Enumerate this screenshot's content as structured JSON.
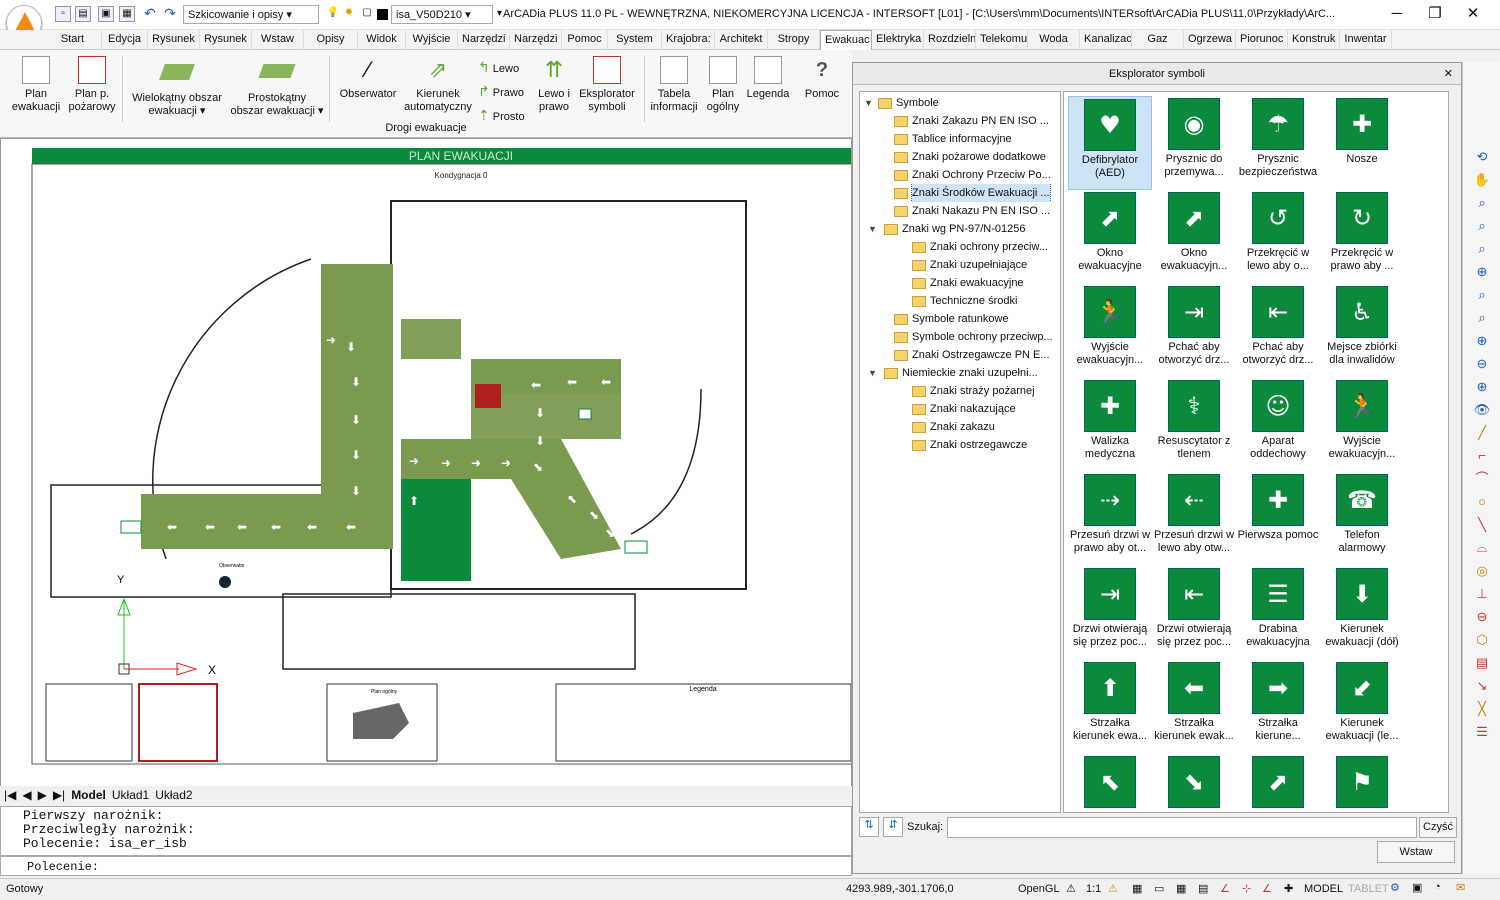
{
  "window": {
    "title": "ArCADia PLUS 11.0 PL - WEWNĘTRZNA, NIEKOMERCYJNA LICENCJA - INTERSOFT [L01] - [C:\\Users\\mm\\Documents\\INTERsoft\\ArCADia PLUS\\11.0\\Przykłady\\ArC...",
    "workspace": "Szkicowanie i opisy",
    "layer": "isa_V50D210"
  },
  "tabs": [
    "Start",
    "Edycja",
    "Rysunek",
    "Rysunek",
    "Wstaw",
    "Opisy",
    "Widok",
    "Wyjście",
    "Narzędzi",
    "Narzędzi",
    "Pomoc",
    "System",
    "Krajobra:",
    "Architekt",
    "Stropy",
    "Ewakuac",
    "Elektryka",
    "Rozdzieln",
    "Telekomu",
    "Woda",
    "Kanalizac",
    "Gaz",
    "Ogrzewa",
    "Piorunoc",
    "Konstruk",
    "Inwentar"
  ],
  "ribbon": {
    "group_label": "Drogi ewakuacje",
    "buttons": {
      "plan_ewak": [
        "Plan",
        "ewakuacji"
      ],
      "plan_poz": [
        "Plan p.",
        "pożarowy"
      ],
      "wielokatny": [
        "Wielokątny obszar",
        "ewakuacji ▾"
      ],
      "prostokatny": [
        "Prostokątny",
        "obszar ewakuacji ▾"
      ],
      "obserwator": [
        "Obserwator"
      ],
      "kierunek": [
        "Kierunek",
        "automatyczny"
      ],
      "lewo": "Lewo",
      "prawo": "Prawo",
      "prosto": "Prosto",
      "lewo_prawo": [
        "Lewo i",
        "prawo"
      ],
      "eksplorator": [
        "Eksplorator",
        "symboli"
      ],
      "tabela": [
        "Tabela",
        "informacji"
      ],
      "plan_ogolny": [
        "Plan",
        "ogólny"
      ],
      "legenda": [
        "Legenda"
      ],
      "pomoc": [
        "Pomoc"
      ]
    }
  },
  "drawing": {
    "title": "PLAN EWAKUACJI",
    "subtitle": "Kondygnacja 0",
    "observer_label": "Obserwator",
    "axis_y": "Y",
    "axis_x": "X",
    "legend_title": "Legenda",
    "plan_ogolny_title": "Plan ogólny"
  },
  "layout_tabs": [
    "Model",
    "Układ1",
    "Układ2"
  ],
  "command": {
    "history": [
      "Pierwszy narożnik:",
      "Przeciwległy narożnik:",
      "Polecenie: isa_er_isb"
    ],
    "prompt": "Polecenie:"
  },
  "status": {
    "state": "Gotowy",
    "coords": "4293.989,-301.1706,0",
    "renderer": "OpenGL",
    "scale": "1:1",
    "mode": "MODEL",
    "tablet": "TABLET"
  },
  "panel": {
    "title": "Eksplorator symboli",
    "search_label": "Szukaj:",
    "search_value": "",
    "clear_button": "Czyść",
    "insert_button": "Wstaw",
    "tree": [
      {
        "label": "Symbole",
        "level": 0,
        "twisty": "▼"
      },
      {
        "label": "Znaki Zakazu PN EN ISO ...",
        "level": 1
      },
      {
        "label": "Tablice informacyjne",
        "level": 1
      },
      {
        "label": "Znaki pożarowe dodatkowe",
        "level": 1
      },
      {
        "label": "Znaki Ochrony Przeciw Po...",
        "level": 1
      },
      {
        "label": "Znaki Środków Ewakuacji ...",
        "level": 1,
        "selected": true
      },
      {
        "label": "Znaki Nakazu PN EN ISO ...",
        "level": 1
      },
      {
        "label": "Znaki wg PN-97/N-01256",
        "level": 1,
        "twisty": "▼"
      },
      {
        "label": "Znaki ochrony przeciw...",
        "level": 2
      },
      {
        "label": "Znaki uzupełniające",
        "level": 2
      },
      {
        "label": "Znaki ewakuacyjne",
        "level": 2
      },
      {
        "label": "Techniczne środki",
        "level": 2
      },
      {
        "label": "Symbole ratunkowe",
        "level": 1
      },
      {
        "label": "Symbole ochrony przeciwp...",
        "level": 1
      },
      {
        "label": "Znaki Ostrzegawcze PN E...",
        "level": 1
      },
      {
        "label": "Niemieckie znaki uzupełni...",
        "level": 1,
        "twisty": "▼"
      },
      {
        "label": "Znaki straży pożarnej",
        "level": 2
      },
      {
        "label": "Znaki nakazujące",
        "level": 2
      },
      {
        "label": "Znaki zakazu",
        "level": 2
      },
      {
        "label": "Znaki ostrzegawcze",
        "level": 2
      }
    ],
    "symbols": [
      {
        "label": "Defibrylator (AED)",
        "glyph": "♥"
      },
      {
        "label": "Prysznic do przemywa...",
        "glyph": "◉"
      },
      {
        "label": "Prysznic bezpieczeństwa",
        "glyph": "☂"
      },
      {
        "label": "Nosze",
        "glyph": "✚"
      },
      {
        "label": "Okno ewakuacyjne",
        "glyph": "⬈"
      },
      {
        "label": "Okno ewakuacyjn...",
        "glyph": "⬈"
      },
      {
        "label": "Przekręcić w lewo aby o...",
        "glyph": "↺"
      },
      {
        "label": "Przekręcić w prawo aby ...",
        "glyph": "↻"
      },
      {
        "label": "Wyjście ewakuacyjn...",
        "glyph": "🏃"
      },
      {
        "label": "Pchać aby otworzyć drz...",
        "glyph": "⇥"
      },
      {
        "label": "Pchać aby otworzyć drz...",
        "glyph": "⇤"
      },
      {
        "label": "Mejsce zbiórki dla inwalidów",
        "glyph": "♿"
      },
      {
        "label": "Walizka medyczna",
        "glyph": "✚"
      },
      {
        "label": "Resuscytator z tlenem",
        "glyph": "⚕"
      },
      {
        "label": "Aparat oddechowy",
        "glyph": "☺"
      },
      {
        "label": "Wyjście ewakuacyjn...",
        "glyph": "🏃"
      },
      {
        "label": "Przesuń drzwi w prawo aby ot...",
        "glyph": "⇢"
      },
      {
        "label": "Przesuń drzwi w lewo aby otw...",
        "glyph": "⇠"
      },
      {
        "label": "Pierwsza pomoc",
        "glyph": "✚"
      },
      {
        "label": "Telefon alarmowy",
        "glyph": "☎"
      },
      {
        "label": "Drzwi otwierają się przez poc...",
        "glyph": "⇥"
      },
      {
        "label": "Drzwi otwierają się przez poc...",
        "glyph": "⇤"
      },
      {
        "label": "Drabina ewakuacyjna",
        "glyph": "☰"
      },
      {
        "label": "Kierunek ewakuacji (dół)",
        "glyph": "⬇"
      },
      {
        "label": "Strzałka kierunek ewa...",
        "glyph": "⬆"
      },
      {
        "label": "Strzałka kierunek ewak...",
        "glyph": "⬅"
      },
      {
        "label": "Strzałka kierune...",
        "glyph": "➡"
      },
      {
        "label": "Kierunek ewakuacji (le...",
        "glyph": "⬋"
      },
      {
        "label": "",
        "glyph": "⬉"
      },
      {
        "label": "",
        "glyph": "⬊"
      },
      {
        "label": "",
        "glyph": "⬈"
      },
      {
        "label": "",
        "glyph": "⚑"
      }
    ]
  },
  "colors": {
    "evac_green": "#7a9a50",
    "sign_green": "#0c8a3c",
    "accent": "#1a5fb4"
  }
}
